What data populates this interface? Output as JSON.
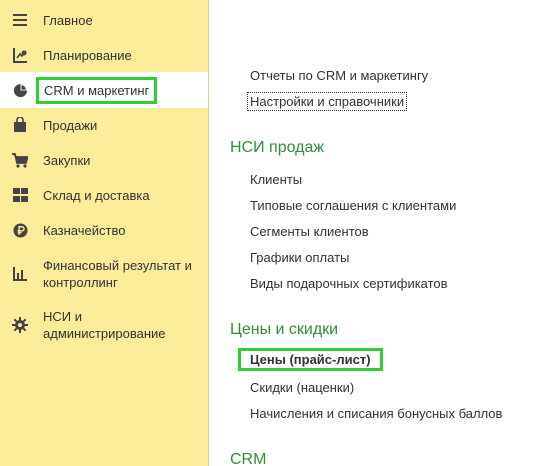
{
  "sidebar": {
    "items": [
      {
        "label": "Главное",
        "icon": "menu-icon"
      },
      {
        "label": "Планирование",
        "icon": "planning-icon"
      },
      {
        "label": "CRM и маркетинг",
        "icon": "pie-chart-icon"
      },
      {
        "label": "Продажи",
        "icon": "shopping-bag-icon"
      },
      {
        "label": "Закупки",
        "icon": "cart-icon"
      },
      {
        "label": "Склад и доставка",
        "icon": "warehouse-icon"
      },
      {
        "label": "Казначейство",
        "icon": "ruble-icon"
      },
      {
        "label": "Финансовый результат и\nконтроллинг",
        "icon": "bar-chart-icon"
      },
      {
        "label": "НСИ и\nадминистрирование",
        "icon": "gear-icon"
      }
    ],
    "active_index": 2
  },
  "content": {
    "top_links": [
      "Отчеты по CRM и маркетингу",
      "Настройки и справочники"
    ],
    "sections": [
      {
        "title": "НСИ продаж",
        "links": [
          "Клиенты",
          "Типовые соглашения с клиентами",
          "Сегменты клиентов",
          "Графики оплаты",
          "Виды подарочных сертификатов"
        ]
      },
      {
        "title": "Цены и скидки",
        "links": [
          "Цены (прайс-лист)",
          "Скидки (наценки)",
          "Начисления и списания бонусных баллов"
        ]
      },
      {
        "title": "CRM",
        "links": []
      }
    ]
  },
  "colors": {
    "sidebar_bg": "#fbec9a",
    "section_title": "#2f8f3a",
    "highlight_border": "#33cc33"
  }
}
